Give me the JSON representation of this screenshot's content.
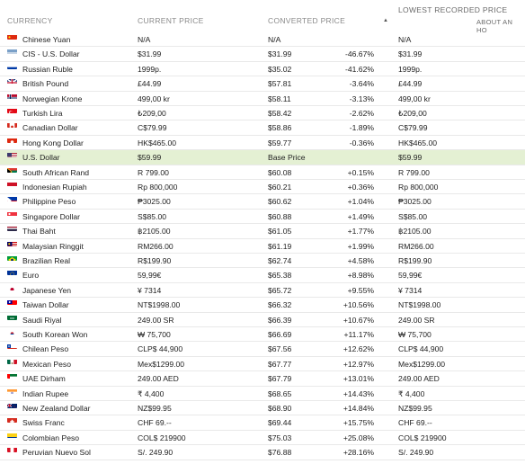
{
  "headers": {
    "currency": "CURRENCY",
    "current_price": "CURRENT PRICE",
    "converted_price": "CONVERTED PRICE",
    "lowest_recorded_price": "LOWEST RECORDED PRICE",
    "about": "ABOUT AN HO"
  },
  "sort_indicator": "▲",
  "rows": [
    {
      "flag": "cn",
      "name": "Chinese Yuan",
      "current": "N/A",
      "converted": "N/A",
      "pct": "",
      "lowest": "N/A",
      "na": true
    },
    {
      "flag": "cis",
      "name": "CIS - U.S. Dollar",
      "current": "$31.99",
      "converted": "$31.99",
      "pct": "-46.67%",
      "lowest": "$31.99"
    },
    {
      "flag": "ru",
      "name": "Russian Ruble",
      "current": "1999р.",
      "converted": "$35.02",
      "pct": "-41.62%",
      "lowest": "1999р."
    },
    {
      "flag": "gb",
      "name": "British Pound",
      "current": "£44.99",
      "converted": "$57.81",
      "pct": "-3.64%",
      "lowest": "£44.99"
    },
    {
      "flag": "no",
      "name": "Norwegian Krone",
      "current": "499,00 kr",
      "converted": "$58.11",
      "pct": "-3.13%",
      "lowest": "499,00 kr"
    },
    {
      "flag": "tr",
      "name": "Turkish Lira",
      "current": "₺209,00",
      "converted": "$58.42",
      "pct": "-2.62%",
      "lowest": "₺209,00"
    },
    {
      "flag": "ca",
      "name": "Canadian Dollar",
      "current": "C$79.99",
      "converted": "$58.86",
      "pct": "-1.89%",
      "lowest": "C$79.99"
    },
    {
      "flag": "hk",
      "name": "Hong Kong Dollar",
      "current": "HK$465.00",
      "converted": "$59.77",
      "pct": "-0.36%",
      "lowest": "HK$465.00"
    },
    {
      "flag": "us",
      "name": "U.S. Dollar",
      "current": "$59.99",
      "converted": "Base Price",
      "pct": "",
      "lowest": "$59.99",
      "base": true
    },
    {
      "flag": "za",
      "name": "South African Rand",
      "current": "R 799.00",
      "converted": "$60.08",
      "pct": "+0.15%",
      "lowest": "R 799.00"
    },
    {
      "flag": "id",
      "name": "Indonesian Rupiah",
      "current": "Rp 800,000",
      "converted": "$60.21",
      "pct": "+0.36%",
      "lowest": "Rp 800,000"
    },
    {
      "flag": "ph",
      "name": "Philippine Peso",
      "current": "₱3025.00",
      "converted": "$60.62",
      "pct": "+1.04%",
      "lowest": "₱3025.00"
    },
    {
      "flag": "sg",
      "name": "Singapore Dollar",
      "current": "S$85.00",
      "converted": "$60.88",
      "pct": "+1.49%",
      "lowest": "S$85.00"
    },
    {
      "flag": "th",
      "name": "Thai Baht",
      "current": "฿2105.00",
      "converted": "$61.05",
      "pct": "+1.77%",
      "lowest": "฿2105.00"
    },
    {
      "flag": "my",
      "name": "Malaysian Ringgit",
      "current": "RM266.00",
      "converted": "$61.19",
      "pct": "+1.99%",
      "lowest": "RM266.00"
    },
    {
      "flag": "br",
      "name": "Brazilian Real",
      "current": "R$199.90",
      "converted": "$62.74",
      "pct": "+4.58%",
      "lowest": "R$199.90"
    },
    {
      "flag": "eu",
      "name": "Euro",
      "current": "59,99€",
      "converted": "$65.38",
      "pct": "+8.98%",
      "lowest": "59,99€"
    },
    {
      "flag": "jp",
      "name": "Japanese Yen",
      "current": "¥ 7314",
      "converted": "$65.72",
      "pct": "+9.55%",
      "lowest": "¥ 7314"
    },
    {
      "flag": "tw",
      "name": "Taiwan Dollar",
      "current": "NT$1998.00",
      "converted": "$66.32",
      "pct": "+10.56%",
      "lowest": "NT$1998.00"
    },
    {
      "flag": "sa",
      "name": "Saudi Riyal",
      "current": "249.00 SR",
      "converted": "$66.39",
      "pct": "+10.67%",
      "lowest": "249.00 SR"
    },
    {
      "flag": "kr",
      "name": "South Korean Won",
      "current": "₩ 75,700",
      "converted": "$66.69",
      "pct": "+11.17%",
      "lowest": "₩ 75,700"
    },
    {
      "flag": "cl",
      "name": "Chilean Peso",
      "current": "CLP$ 44,900",
      "converted": "$67.56",
      "pct": "+12.62%",
      "lowest": "CLP$ 44,900"
    },
    {
      "flag": "mx",
      "name": "Mexican Peso",
      "current": "Mex$1299.00",
      "converted": "$67.77",
      "pct": "+12.97%",
      "lowest": "Mex$1299.00"
    },
    {
      "flag": "ae",
      "name": "UAE Dirham",
      "current": "249.00 AED",
      "converted": "$67.79",
      "pct": "+13.01%",
      "lowest": "249.00 AED"
    },
    {
      "flag": "in",
      "name": "Indian Rupee",
      "current": "₹ 4,400",
      "converted": "$68.65",
      "pct": "+14.43%",
      "lowest": "₹ 4,400"
    },
    {
      "flag": "nz",
      "name": "New Zealand Dollar",
      "current": "NZ$99.95",
      "converted": "$68.90",
      "pct": "+14.84%",
      "lowest": "NZ$99.95"
    },
    {
      "flag": "ch",
      "name": "Swiss Franc",
      "current": "CHF 69.--",
      "converted": "$69.44",
      "pct": "+15.75%",
      "lowest": "CHF 69.--"
    },
    {
      "flag": "co",
      "name": "Colombian Peso",
      "current": "COL$ 219900",
      "converted": "$75.03",
      "pct": "+25.08%",
      "lowest": "COL$ 219900"
    },
    {
      "flag": "pe",
      "name": "Peruvian Nuevo Sol",
      "current": "S/. 249.90",
      "converted": "$76.88",
      "pct": "+28.16%",
      "lowest": "S/. 249.90"
    }
  ]
}
